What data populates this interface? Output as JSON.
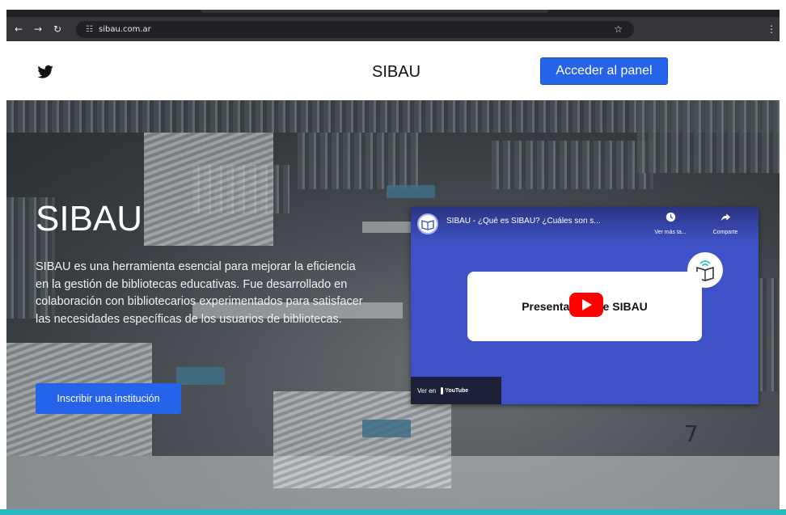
{
  "browser": {
    "url": "sibau.com.ar",
    "back_icon": "arrow-left",
    "forward_icon": "arrow-right",
    "reload_icon": "reload",
    "tune_icon": "site-settings",
    "star_icon": "star",
    "menu_icon": "kebab-menu"
  },
  "header": {
    "social_icon": "twitter",
    "brand": "SIBAU",
    "panel_button": "Acceder al panel"
  },
  "hero": {
    "title": "SIBAU",
    "description": "SIBAU es una herramienta esencial para mejorar la eficiencia en la gestión de bibliotecas educativas. Fue desarrollado en colaboración con bibliotecarios experimentados para satisfacer las necesidades específicas de los usuarios de bibliotecas.",
    "cta_button": "Inscribir una institución",
    "background_number": "7"
  },
  "video": {
    "title": "SIBAU - ¿Qué es SIBAU? ¿Cuáles son s...",
    "watch_later": "Ver más ta...",
    "share": "Comparte",
    "preview_text": "Presentación de SIBAU",
    "watch_on": "Ver en",
    "platform": "YouTube"
  },
  "colors": {
    "primary_button": "#2563eb",
    "video_background": "#3f51c6",
    "play_button": "#ff0000",
    "bottom_bar": "#2bb6c4"
  }
}
